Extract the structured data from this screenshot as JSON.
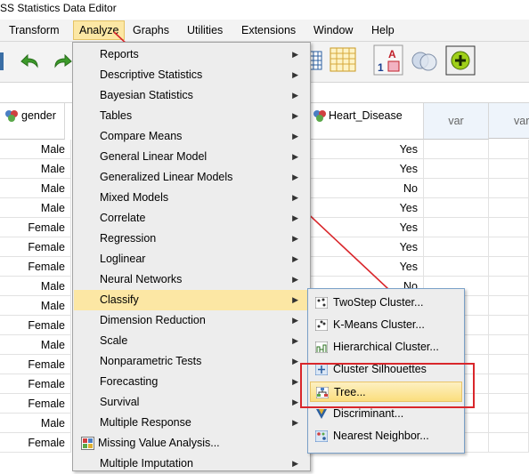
{
  "window": {
    "title": "SS Statistics Data Editor"
  },
  "menubar": {
    "items": [
      "Transform",
      "Analyze",
      "Graphs",
      "Utilities",
      "Extensions",
      "Window",
      "Help"
    ]
  },
  "grid": {
    "headers": {
      "gender": "gender",
      "heart_disease": "Heart_Disease",
      "var1": "var",
      "var2": "var"
    },
    "gender_values": [
      "Male",
      "Male",
      "Male",
      "Male",
      "Female",
      "Female",
      "Female",
      "Male",
      "Male",
      "Female",
      "Male",
      "Female",
      "Female",
      "Female",
      "Male",
      "Female"
    ],
    "heart_values": [
      "Yes",
      "Yes",
      "No",
      "Yes",
      "Yes",
      "Yes",
      "Yes",
      "No",
      "",
      "",
      "",
      "",
      "",
      "",
      "",
      "Yes"
    ]
  },
  "analyze_menu": {
    "items": [
      "Reports",
      "Descriptive Statistics",
      "Bayesian Statistics",
      "Tables",
      "Compare Means",
      "General Linear Model",
      "Generalized Linear Models",
      "Mixed Models",
      "Correlate",
      "Regression",
      "Loglinear",
      "Neural Networks",
      "Classify",
      "Dimension Reduction",
      "Scale",
      "Nonparametric Tests",
      "Forecasting",
      "Survival",
      "Multiple Response",
      "Missing Value Analysis...",
      "Multiple Imputation"
    ],
    "highlighted": "Classify"
  },
  "classify_submenu": {
    "items": [
      "TwoStep Cluster...",
      "K-Means Cluster...",
      "Hierarchical Cluster...",
      "Cluster Silhouettes",
      "Tree...",
      "Discriminant...",
      "Nearest Neighbor..."
    ],
    "highlighted": "Tree..."
  },
  "annotation": {
    "arrow_color": "#d9262b",
    "box_color": "#d9262b"
  },
  "colors": {
    "highlight": "#fce7a4",
    "menu_bg": "#ededed"
  }
}
